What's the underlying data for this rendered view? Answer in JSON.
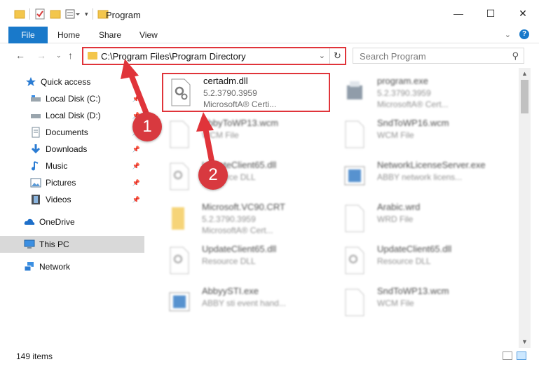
{
  "window": {
    "title": "Program"
  },
  "ribbon": {
    "tabs": [
      "File",
      "Home",
      "Share",
      "View"
    ],
    "help": "?"
  },
  "address": {
    "path": "C:\\Program Files\\Program Directory"
  },
  "search": {
    "placeholder": "Search Program"
  },
  "sidebar": {
    "items": [
      {
        "label": "Quick access",
        "icon": "star-icon"
      },
      {
        "label": "Local Disk (C:)",
        "icon": "drive-icon"
      },
      {
        "label": "Local Disk (D:)",
        "icon": "drive-icon"
      },
      {
        "label": "Documents",
        "icon": "documents-icon"
      },
      {
        "label": "Downloads",
        "icon": "downloads-icon"
      },
      {
        "label": "Music",
        "icon": "music-icon"
      },
      {
        "label": "Pictures",
        "icon": "pictures-icon"
      },
      {
        "label": "Videos",
        "icon": "videos-icon"
      },
      {
        "label": "OneDrive",
        "icon": "cloud-icon"
      },
      {
        "label": "This PC",
        "icon": "computer-icon"
      },
      {
        "label": "Network",
        "icon": "network-icon"
      }
    ]
  },
  "files": [
    {
      "name": "certadm.dll",
      "line2": "5.2.3790.3959",
      "line3": "MicrosoftA® Certi..."
    },
    {
      "name": "program.exe",
      "line2": "5.2.3790.3959",
      "line3": "MicrosoftA® Cert..."
    },
    {
      "name": "AbbyToWP13.wcm",
      "line2": "WCM File",
      "line3": ""
    },
    {
      "name": "SndToWP16.wcm",
      "line2": "WCM File",
      "line3": ""
    },
    {
      "name": "UpdateClient65.dll",
      "line2": "Resource DLL",
      "line3": ""
    },
    {
      "name": "NetworkLicenseServer.exe",
      "line2": "ABBY network licens...",
      "line3": ""
    },
    {
      "name": "Microsoft.VC90.CRT",
      "line2": "5.2.3790.3959",
      "line3": "MicrosoftA® Cert..."
    },
    {
      "name": "Arabic.wrd",
      "line2": "WRD File",
      "line3": ""
    },
    {
      "name": "UpdateClient65.dll",
      "line2": "Resource DLL",
      "line3": ""
    },
    {
      "name": "UpdateClient65.dll",
      "line2": "Resource DLL",
      "line3": ""
    },
    {
      "name": "AbbyySTI.exe",
      "line2": "ABBY sti event hand...",
      "line3": ""
    },
    {
      "name": "SndToWP13.wcm",
      "line2": "WCM File",
      "line3": ""
    }
  ],
  "status": {
    "count": "149 items"
  },
  "annotations": {
    "badge1": "1",
    "badge2": "2",
    "color": "#e0343a"
  }
}
